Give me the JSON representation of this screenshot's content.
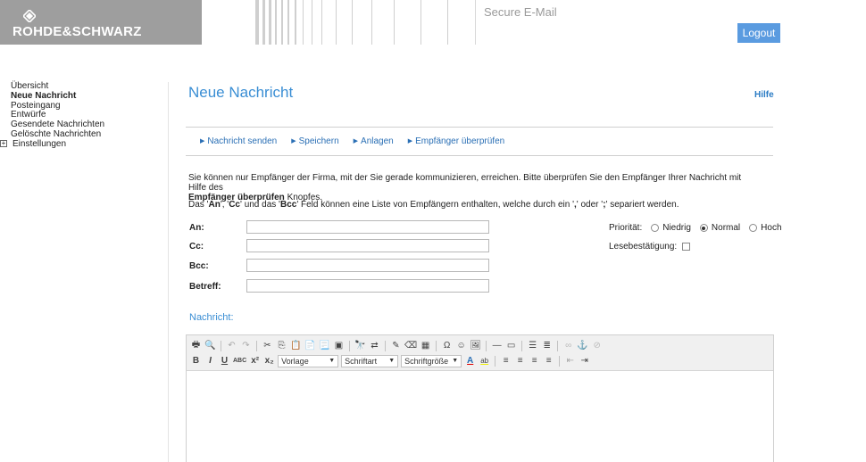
{
  "header": {
    "brand": "ROHDE&SCHWARZ",
    "app_title": "Secure E-Mail",
    "logout_label": "Logout"
  },
  "sidebar": {
    "items": [
      {
        "label": "Übersicht"
      },
      {
        "label": "Neue Nachricht",
        "active": true
      },
      {
        "label": "Posteingang"
      },
      {
        "label": "Entwürfe"
      },
      {
        "label": "Gesendete Nachrichten"
      },
      {
        "label": "Gelöschte Nachrichten"
      },
      {
        "label": "Einstellungen",
        "expandable": true
      }
    ]
  },
  "main": {
    "title": "Neue Nachricht",
    "help_label": "Hilfe",
    "actions": [
      "Nachricht senden",
      "Speichern",
      "Anlagen",
      "Empfänger überprüfen"
    ],
    "info_line1": "Sie können nur Empfänger der Firma, mit der Sie gerade kommunizieren, erreichen. Bitte überprüfen Sie den Empfänger Ihrer Nachricht mit Hilfe des",
    "info_bold": "Empfänger überprüfen",
    "info_tail": " Knopfes.",
    "info2_parts": [
      "Das '",
      "An",
      "', '",
      "Cc",
      "' und das '",
      "Bcc",
      "' Feld können eine Liste von Empfängern enthalten, welche durch ein '",
      ",",
      "' oder '",
      ";",
      "' separiert werden."
    ],
    "fields": {
      "to_label": "An:",
      "cc_label": "Cc:",
      "bcc_label": "Bcc:",
      "subject_label": "Betreff:",
      "to_value": "",
      "cc_value": "",
      "bcc_value": "",
      "subject_value": ""
    },
    "priority": {
      "label": "Priorität:",
      "options": [
        "Niedrig",
        "Normal",
        "Hoch"
      ],
      "selected": "Normal"
    },
    "read_receipt": {
      "label": "Lesebestätigung:",
      "checked": false
    },
    "message_label": "Nachricht:"
  },
  "editor": {
    "style_select": "Vorlage",
    "font_select": "Schriftart",
    "size_select": "Schriftgröße"
  },
  "colors": {
    "accent": "#3a8ed4",
    "logout_bg": "#5a9be0",
    "header_gray": "#9e9e9e"
  }
}
